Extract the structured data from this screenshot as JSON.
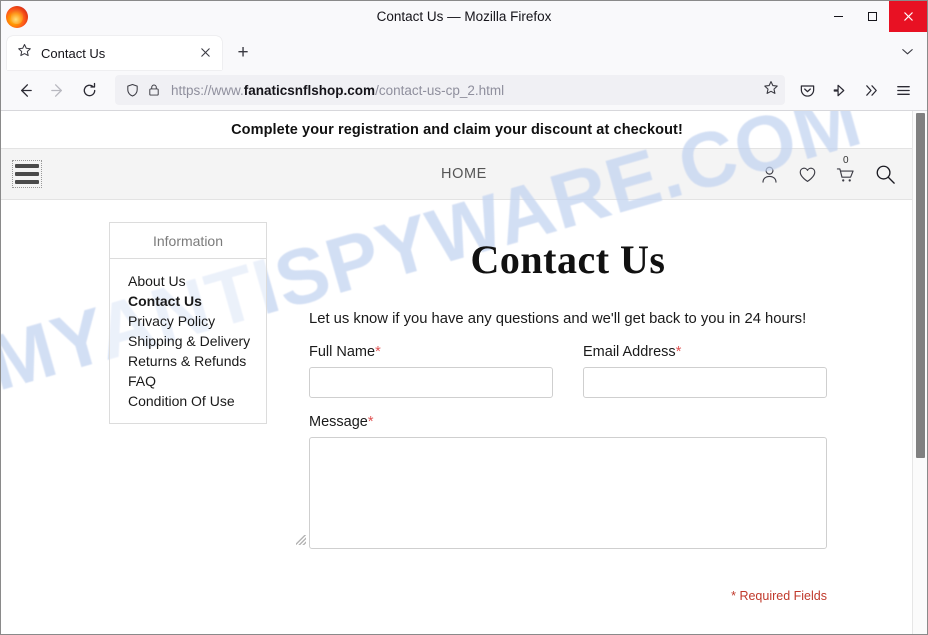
{
  "browser": {
    "window_title": "Contact Us — Mozilla Firefox",
    "minimize_label": "—",
    "maximize_label": "□",
    "close_label": "✕",
    "tab": {
      "title": "Contact Us",
      "close_label": "✕",
      "star_icon": "star-icon"
    },
    "new_tab_label": "+",
    "back_label": "←",
    "forward_label": "→",
    "reload_label": "⟳",
    "url": {
      "prefix": "https://www.",
      "domain": "fanaticsnflshop.com",
      "path": "/contact-us-cp_2.html"
    },
    "overflow_label": "»",
    "menu_label": "≡"
  },
  "site": {
    "promo_banner": "Complete your registration and claim your discount at checkout!",
    "nav": {
      "home": "HOME"
    },
    "header_icons": {
      "account": "account-icon",
      "wishlist": "heart-icon",
      "cart": "cart-icon",
      "cart_count": "0",
      "search": "search-icon"
    },
    "watermark": "MYANTISPYWARE.COM"
  },
  "sidebar": {
    "title": "Information",
    "items": [
      {
        "label": "About Us",
        "active": false
      },
      {
        "label": "Contact Us",
        "active": true
      },
      {
        "label": "Privacy Policy",
        "active": false
      },
      {
        "label": "Shipping & Delivery",
        "active": false
      },
      {
        "label": "Returns & Refunds",
        "active": false
      },
      {
        "label": "FAQ",
        "active": false
      },
      {
        "label": "Condition Of Use",
        "active": false
      }
    ]
  },
  "main": {
    "page_title": "Contact Us",
    "intro": "Let us know if you have any questions and we'll get back to you in 24 hours!",
    "fields": {
      "full_name": {
        "label": "Full Name",
        "required_mark": "*",
        "value": "",
        "placeholder": ""
      },
      "email": {
        "label": "Email Address",
        "required_mark": "*",
        "value": "",
        "placeholder": ""
      },
      "message": {
        "label": "Message",
        "required_mark": "*",
        "value": "",
        "placeholder": ""
      }
    },
    "required_note": "* Required Fields"
  },
  "colors": {
    "required_red": "#e05252",
    "note_red": "#c0392b",
    "close_button_red": "#e81123",
    "watermark_blue": "#c2d3f0",
    "header_bg": "#f4f4f4"
  }
}
